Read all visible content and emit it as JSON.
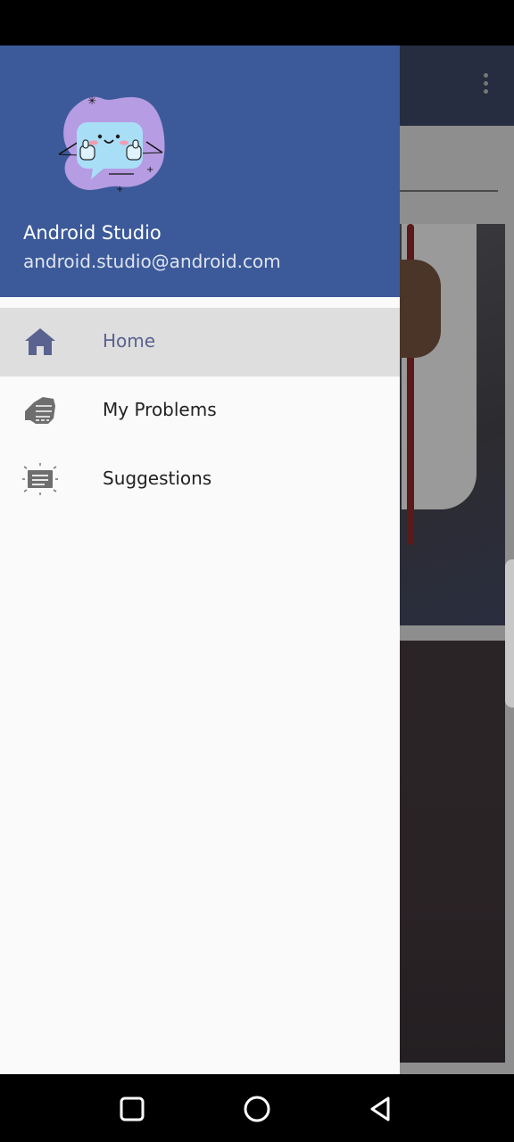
{
  "drawer": {
    "header": {
      "user_name": "Android Studio",
      "user_email": "android.studio@android.com",
      "background_color": "#3c5a9a",
      "avatar": "thumbs-up-chat-bubble-illustration"
    },
    "items": [
      {
        "label": "Home",
        "icon": "home-icon",
        "selected": true
      },
      {
        "label": "My Problems",
        "icon": "fist-icon",
        "selected": false
      },
      {
        "label": "Suggestions",
        "icon": "suggestion-board-icon",
        "selected": false
      }
    ]
  },
  "background_app": {
    "toolbar_color": "#272d40",
    "overflow_menu_icon": "more-vertical-icon"
  },
  "nav_bar": {
    "buttons": [
      "recent-apps-icon",
      "home-circle-icon",
      "back-triangle-icon"
    ]
  },
  "colors": {
    "accent_selected_text": "#5a6290",
    "selected_row": "#dedede"
  }
}
